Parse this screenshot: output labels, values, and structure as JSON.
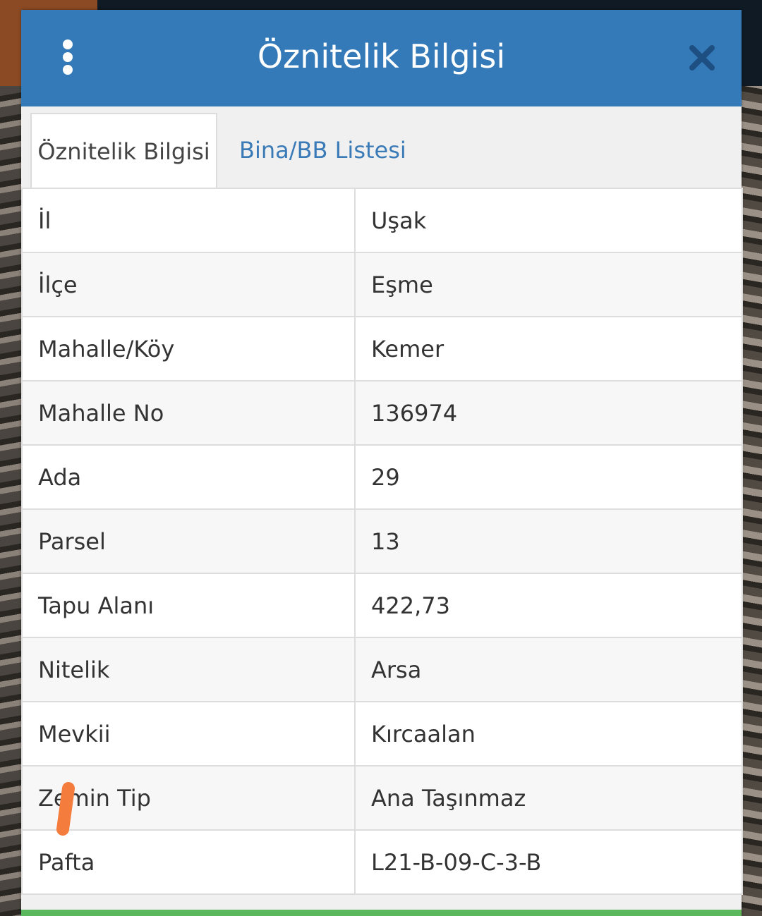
{
  "header": {
    "title": "Öznitelik Bilgisi",
    "menu_icon": "vertical-dots-icon",
    "close_icon": "close-x-icon",
    "bg_color": "#3479b8"
  },
  "tabs": [
    {
      "label": "Öznitelik Bilgisi",
      "active": true
    },
    {
      "label": "Bina/BB Listesi",
      "active": false
    }
  ],
  "attributes": [
    {
      "key": "İl",
      "value": "Uşak"
    },
    {
      "key": "İlçe",
      "value": "Eşme"
    },
    {
      "key": "Mahalle/Köy",
      "value": "Kemer"
    },
    {
      "key": "Mahalle No",
      "value": "136974"
    },
    {
      "key": "Ada",
      "value": "29"
    },
    {
      "key": "Parsel",
      "value": "13"
    },
    {
      "key": "Tapu Alanı",
      "value": "422,73"
    },
    {
      "key": "Nitelik",
      "value": "Arsa"
    },
    {
      "key": "Mevkii",
      "value": "Kırcaalan"
    },
    {
      "key": "Zemin Tip",
      "value": "Ana Taşınmaz"
    },
    {
      "key": "Pafta",
      "value": "L21-B-09-C-3-B"
    }
  ],
  "colors": {
    "tab_link": "#3a7ab7",
    "bottom_bar": "#5cb85c",
    "annotation_mark": "#f47c3c"
  }
}
